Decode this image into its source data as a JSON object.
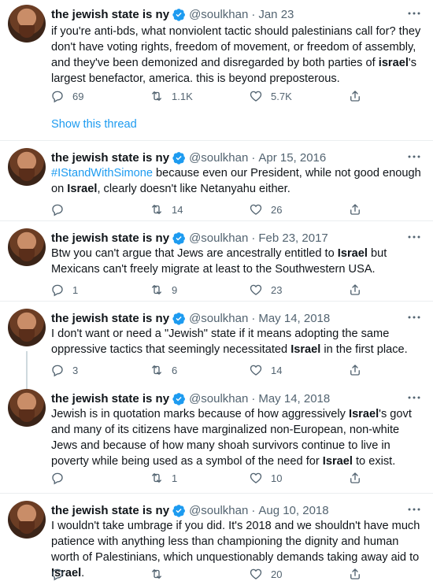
{
  "author": {
    "name": "the jewish state is ny",
    "handle": "@soulkhan",
    "separator": "·"
  },
  "show_thread": "Show this thread",
  "colors": {
    "link": "#1d9bf0",
    "muted": "#536471",
    "verified": "#1d9bf0"
  },
  "tweets": [
    {
      "date": "Jan 23",
      "segments": [
        {
          "t": "if you're anti-bds, what nonviolent tactic should palestinians call for? they don't have voting rights, freedom of movement, or freedom of assembly, and they've been demonized and disregarded by both parties of "
        },
        {
          "t": "israel",
          "b": true
        },
        {
          "t": "'s largest benefactor, america. this is beyond preposterous."
        }
      ],
      "replies": "69",
      "retweets": "1.1K",
      "likes": "5.7K"
    },
    {
      "date": "Apr 15, 2016",
      "segments": [
        {
          "t": "#IStandWithSimone",
          "h": true
        },
        {
          "t": " because even our President, while not good enough on "
        },
        {
          "t": "Israel",
          "b": true
        },
        {
          "t": ", clearly doesn't like Netanyahu either."
        }
      ],
      "replies": "",
      "retweets": "14",
      "likes": "26"
    },
    {
      "date": "Feb 23, 2017",
      "segments": [
        {
          "t": "Btw you can't argue that Jews are ancestrally entitled to "
        },
        {
          "t": "Israel",
          "b": true
        },
        {
          "t": " but Mexicans can't freely migrate at least to the Southwestern USA."
        }
      ],
      "replies": "1",
      "retweets": "9",
      "likes": "23"
    },
    {
      "date": "May 14, 2018",
      "segments": [
        {
          "t": "I don't want or need a \"Jewish\" state if it means adopting the same oppressive tactics that seemingly necessitated "
        },
        {
          "t": "Israel",
          "b": true
        },
        {
          "t": " in the first place."
        }
      ],
      "replies": "3",
      "retweets": "6",
      "likes": "14"
    },
    {
      "date": "May 14, 2018",
      "segments": [
        {
          "t": "Jewish is in quotation marks because of how aggressively "
        },
        {
          "t": "Israel",
          "b": true
        },
        {
          "t": "'s govt and many of its citizens have marginalized non-European, non-white Jews and because of how many shoah survivors continue to live in poverty while being used as a symbol of the need for "
        },
        {
          "t": "Israel",
          "b": true
        },
        {
          "t": " to exist."
        }
      ],
      "replies": "",
      "retweets": "1",
      "likes": "10"
    },
    {
      "date": "Aug 10, 2018",
      "segments": [
        {
          "t": "I wouldn't take umbrage if you did. It's 2018 and we shouldn't have much patience with anything less than championing the dignity and human worth of Palestinians, which unquestionably demands taking away aid to "
        },
        {
          "t": "Israel",
          "b": true
        },
        {
          "t": "."
        }
      ],
      "replies": "",
      "retweets": "",
      "likes": "20"
    }
  ]
}
